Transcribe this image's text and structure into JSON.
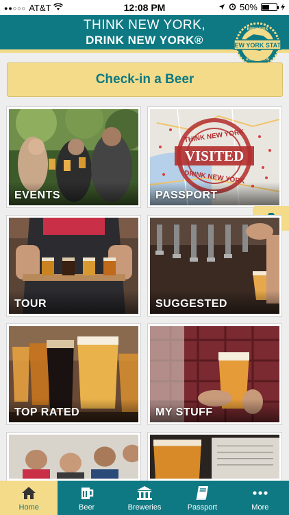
{
  "status": {
    "carrier": "AT&T",
    "time": "12:08 PM",
    "battery": "50%",
    "battery_level": 0.5
  },
  "header": {
    "line1": "THINK NEW YORK,",
    "line2": "DRINK NEW YORK®",
    "badge": {
      "top_text": "BREWERS",
      "main_text": "NEW YORK STATE",
      "bottom_text": "ASSOCIATION"
    }
  },
  "checkin_label": "Check-in a Beer",
  "tiles": [
    {
      "label": "EVENTS"
    },
    {
      "label": "PASSPORT",
      "stamp_top": "THINK NEW YORK",
      "stamp_main": "VISITED",
      "stamp_bottom": "DRINK NEW YORK"
    },
    {
      "label": "TOUR"
    },
    {
      "label": "SUGGESTED"
    },
    {
      "label": "TOP RATED"
    },
    {
      "label": "MY STUFF"
    }
  ],
  "tabs": [
    {
      "label": "Home",
      "icon": "home-icon",
      "active": true
    },
    {
      "label": "Beer",
      "icon": "beer-mug-icon",
      "active": false
    },
    {
      "label": "Breweries",
      "icon": "building-columns-icon",
      "active": false
    },
    {
      "label": "Passport",
      "icon": "book-icon",
      "active": false
    },
    {
      "label": "More",
      "icon": "more-dots-icon",
      "active": false
    }
  ],
  "colors": {
    "teal": "#0e7983",
    "gold": "#f3db8a"
  }
}
